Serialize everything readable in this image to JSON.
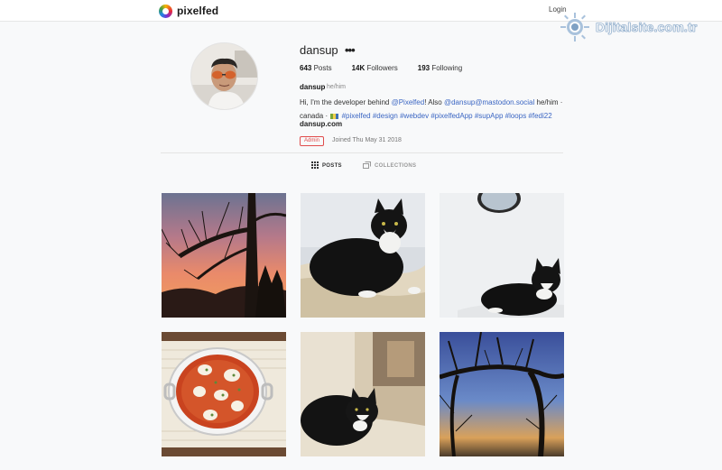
{
  "header": {
    "brand": "pixelfed",
    "login": "Login"
  },
  "watermark": {
    "text": "Dijitalsite.com.tr"
  },
  "profile": {
    "username": "dansup",
    "more": "•••",
    "stats": [
      {
        "count": "643",
        "label": "Posts"
      },
      {
        "count": "14K",
        "label": "Followers"
      },
      {
        "count": "193",
        "label": "Following"
      }
    ],
    "display_name": "dansup",
    "pronouns": "he/him",
    "bio": {
      "text1": "Hi, I'm the developer behind ",
      "link1": "@Pixelfed",
      "text2": "! Also ",
      "link2": "@dansup@mastodon.social",
      "text3": " he/him ·",
      "text4": "canada · ",
      "tags": "#pixelfed #design #webdev #pixelfedApp #supApp #loops #fedi22"
    },
    "website": "dansup.com",
    "badge": "Admin",
    "joined": "Joined Thu May 31 2018"
  },
  "tabs": [
    {
      "label": "POSTS",
      "icon": "grid-icon",
      "active": true
    },
    {
      "label": "COLLECTIONS",
      "icon": "collections-icon",
      "active": false
    }
  ],
  "colors": {
    "accent": "#3b66c3",
    "admin": "#e04c4c",
    "background": "#f8f9fa"
  },
  "posts": [
    {
      "subject": "bare tree silhouette at sunset"
    },
    {
      "subject": "black and white cat on a blanket"
    },
    {
      "subject": "black and white cat lying by a mirror"
    },
    {
      "subject": "shakshuka in a white pan"
    },
    {
      "subject": "black and white cat on a cushion"
    },
    {
      "subject": "tree branches against blue sky"
    }
  ]
}
